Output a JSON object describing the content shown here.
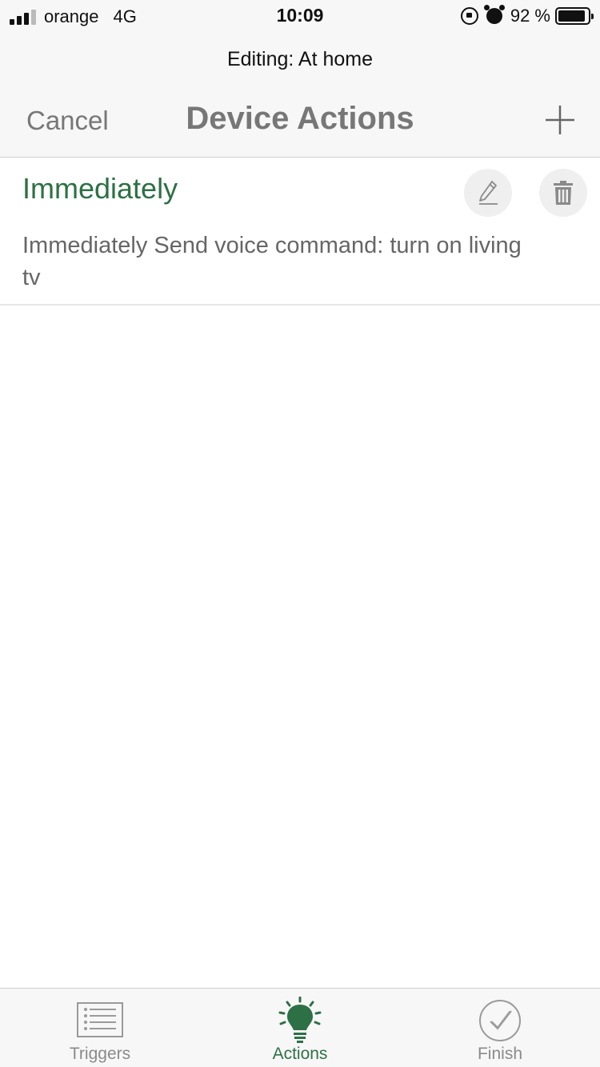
{
  "status_bar": {
    "carrier": "orange",
    "network": "4G",
    "time": "10:09",
    "battery_percent": "92 %",
    "battery_level": 0.92
  },
  "nav": {
    "subtitle": "Editing: At home",
    "cancel_label": "Cancel",
    "title": "Device Actions",
    "add_icon": "plus-icon"
  },
  "actions": [
    {
      "title": "Immediately",
      "description": "Immediately Send voice command: turn on living tv",
      "edit_icon": "pencil-icon",
      "delete_icon": "trash-icon"
    }
  ],
  "tabs": [
    {
      "label": "Triggers",
      "icon": "list-icon",
      "active": false
    },
    {
      "label": "Actions",
      "icon": "lightbulb-icon",
      "active": true
    },
    {
      "label": "Finish",
      "icon": "checkmark-circle-icon",
      "active": false
    }
  ],
  "colors": {
    "accent_green": "#2e7045",
    "muted_gray": "#777777",
    "bar_background": "#f7f7f7"
  }
}
